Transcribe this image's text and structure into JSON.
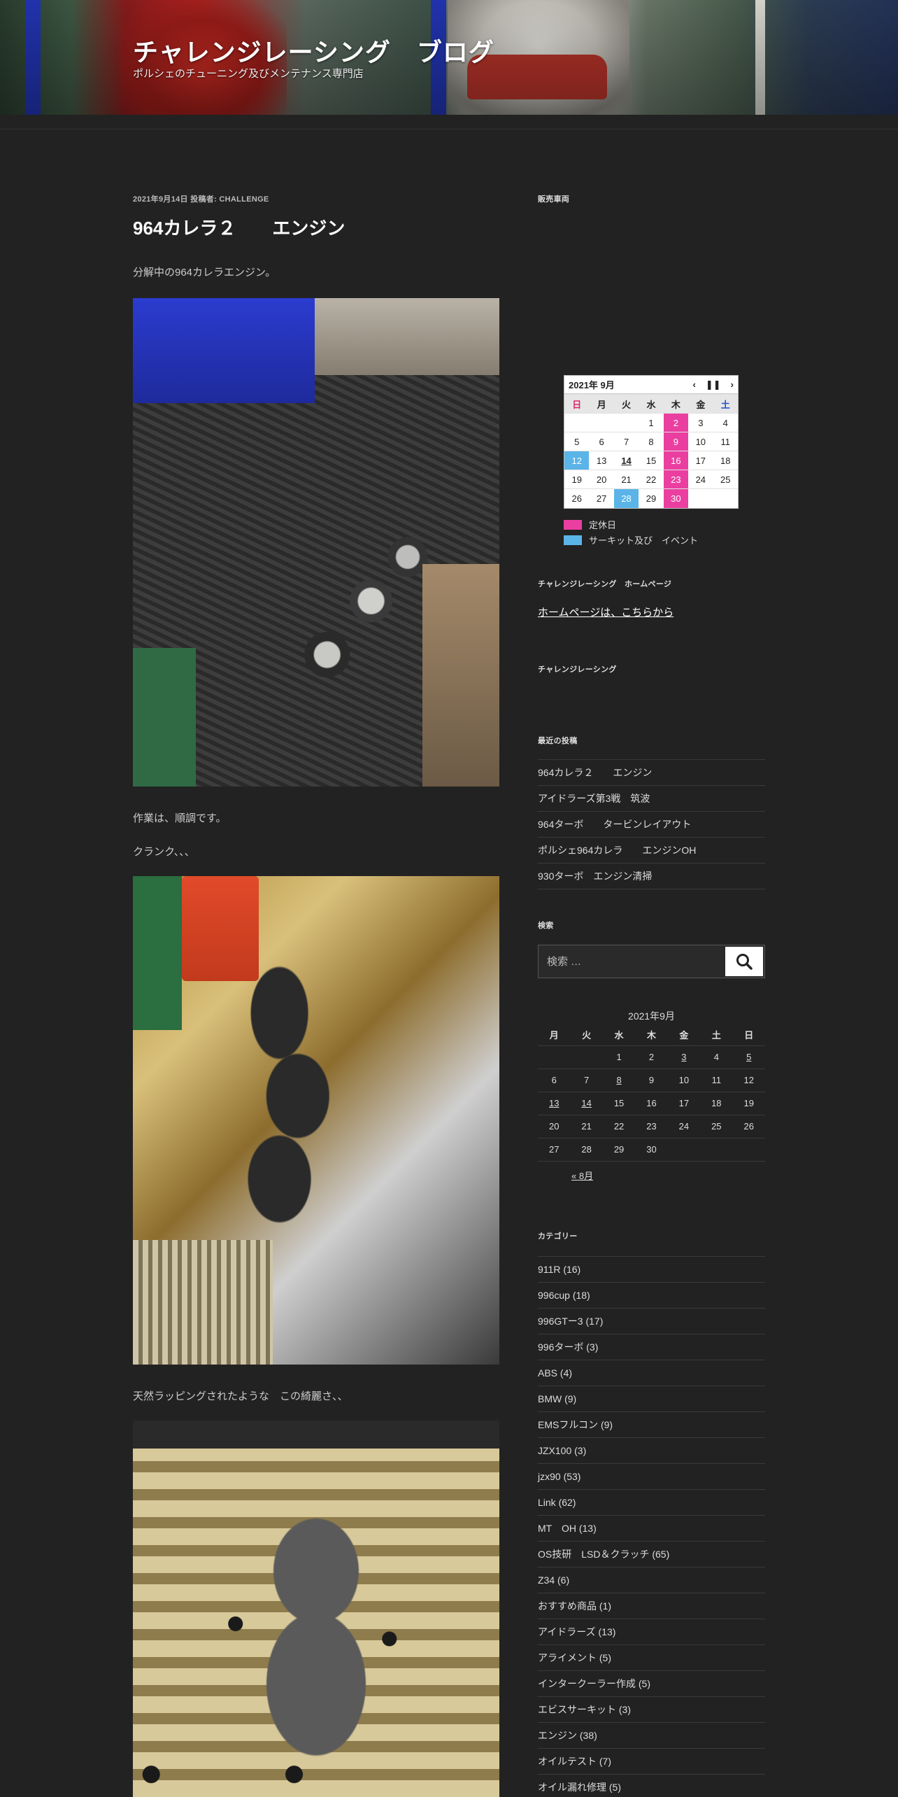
{
  "header": {
    "title": "チャレンジレーシング　ブログ",
    "description": "ポルシェのチューニング及びメンテナンス専門店"
  },
  "post": {
    "date": "2021年9月14日",
    "author_prefix": "投稿者:",
    "author": "challenge",
    "title": "964カレラ２　　エンジン",
    "paragraphs": [
      "分解中の964カレラエンジン。",
      "作業は、順調です。",
      "クランク、、、",
      "天然ラッピングされたような　この綺麗さ、、"
    ]
  },
  "sidebar": {
    "sale_title": "販売車両",
    "business_calendar": {
      "month": "2021年 9月",
      "weekdays": [
        "日",
        "月",
        "火",
        "水",
        "木",
        "金",
        "土"
      ],
      "weeks": [
        [
          "",
          "",
          "",
          "1",
          "2",
          "3",
          "4"
        ],
        [
          "5",
          "6",
          "7",
          "8",
          "9",
          "10",
          "11"
        ],
        [
          "12",
          "13",
          "14",
          "15",
          "16",
          "17",
          "18"
        ],
        [
          "19",
          "20",
          "21",
          "22",
          "23",
          "24",
          "25"
        ],
        [
          "26",
          "27",
          "28",
          "29",
          "30",
          "",
          ""
        ]
      ],
      "holidays": [
        "2",
        "9",
        "16",
        "23",
        "30"
      ],
      "events": [
        "12",
        "28"
      ],
      "today": "14",
      "legend_holiday": "定休日",
      "legend_event": "サーキット及び　イベント",
      "holiday_color": "#ea3fa0",
      "event_color": "#5ab4e8"
    },
    "homepage_title": "チャレンジレーシング　ホームページ",
    "homepage_link": "ホームページは、こちらから",
    "challenge_title": "チャレンジレーシング",
    "recent_title": "最近の投稿",
    "recent_posts": [
      "964カレラ２　　エンジン",
      "アイドラーズ第3戦　筑波",
      "964ターボ　　タービンレイアウト",
      "ポルシェ964カレラ　　エンジンOH",
      "930ターボ　エンジン清掃"
    ],
    "search_title": "検索",
    "search_placeholder": "検索 …",
    "archive_calendar": {
      "caption": "2021年9月",
      "weekdays": [
        "月",
        "火",
        "水",
        "木",
        "金",
        "土",
        "日"
      ],
      "weeks": [
        [
          "",
          "",
          "1",
          "2",
          "3",
          "4",
          "5"
        ],
        [
          "6",
          "7",
          "8",
          "9",
          "10",
          "11",
          "12"
        ],
        [
          "13",
          "14",
          "15",
          "16",
          "17",
          "18",
          "19"
        ],
        [
          "20",
          "21",
          "22",
          "23",
          "24",
          "25",
          "26"
        ],
        [
          "27",
          "28",
          "29",
          "30",
          "",
          "",
          ""
        ]
      ],
      "linked_days": [
        "3",
        "5",
        "8",
        "13",
        "14"
      ],
      "prev_link": "« 8月"
    },
    "categories_title": "カテゴリー",
    "categories": [
      "911R (16)",
      "996cup (18)",
      "996GTー3 (17)",
      "996ターボ (3)",
      "ABS (4)",
      "BMW (9)",
      "EMSフルコン (9)",
      "JZX100 (3)",
      "jzx90 (53)",
      "Link (62)",
      "MT　OH (13)",
      "OS技研　LSD＆クラッチ (65)",
      "Z34 (6)",
      "おすすめ商品 (1)",
      "アイドラーズ (13)",
      "アライメント (5)",
      "インタークーラー作成 (5)",
      "エビスサーキット (3)",
      "エンジン (38)",
      "オイルテスト (7)",
      "オイル漏れ修理 (5)"
    ]
  }
}
